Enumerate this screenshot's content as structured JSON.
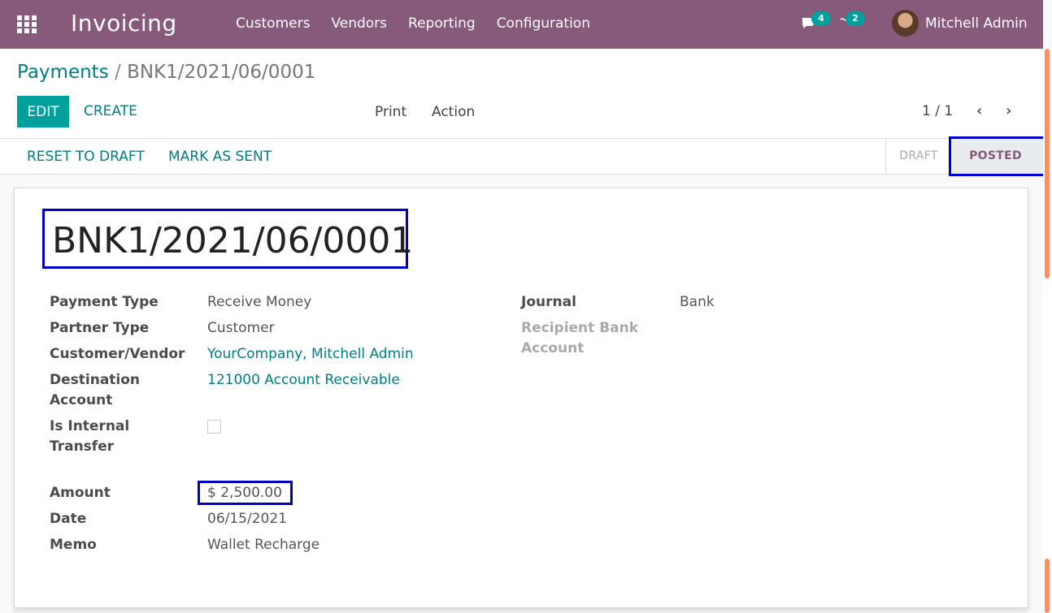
{
  "navbar": {
    "app_title": "Invoicing",
    "menu": [
      "Customers",
      "Vendors",
      "Reporting",
      "Configuration"
    ],
    "chat_badge": "4",
    "activity_badge": "2",
    "user_name": "Mitchell Admin"
  },
  "breadcrumb": {
    "parent": "Payments",
    "separator": "/",
    "current": "BNK1/2021/06/0001"
  },
  "buttons": {
    "edit": "EDIT",
    "create": "CREATE",
    "print": "Print",
    "action": "Action"
  },
  "pager": {
    "value": "1 / 1"
  },
  "statusbar": {
    "reset_to_draft": "RESET TO DRAFT",
    "mark_as_sent": "MARK AS SENT",
    "stages": [
      "DRAFT",
      "POSTED"
    ],
    "active_stage": "POSTED"
  },
  "record": {
    "name": "BNK1/2021/06/0001",
    "left_fields": [
      {
        "label": "Payment Type",
        "value": "Receive Money"
      },
      {
        "label": "Partner Type",
        "value": "Customer"
      },
      {
        "label": "Customer/Vendor",
        "value": "YourCompany, Mitchell Admin"
      },
      {
        "label": "Destination Account",
        "value": "121000 Account Receivable"
      },
      {
        "label": "Is Internal Transfer",
        "value": ""
      },
      {
        "label": "Amount",
        "value": "$ 2,500.00"
      },
      {
        "label": "Date",
        "value": "06/15/2021"
      },
      {
        "label": "Memo",
        "value": "Wallet Recharge"
      }
    ],
    "right_fields": [
      {
        "label": "Journal",
        "value": "Bank"
      },
      {
        "label": "Recipient Bank Account",
        "value": ""
      }
    ]
  },
  "colors": {
    "navbar": "#875a7b",
    "accent": "#00a09d",
    "link": "#017e84",
    "highlight": "#0000cc"
  }
}
